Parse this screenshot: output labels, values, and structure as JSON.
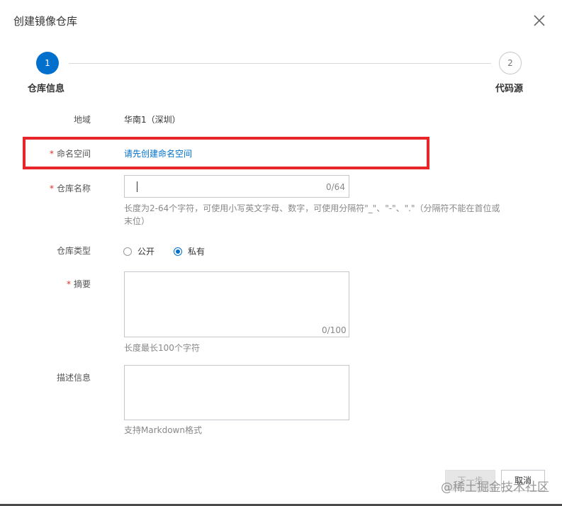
{
  "dialog": {
    "title": "创建镜像仓库",
    "close_icon": "close-icon"
  },
  "steps": [
    {
      "number": "1",
      "label": "仓库信息",
      "active": true
    },
    {
      "number": "2",
      "label": "代码源",
      "active": false
    }
  ],
  "form": {
    "region": {
      "label": "地域",
      "value": "华南1（深圳）"
    },
    "namespace": {
      "label": "命名空间",
      "required": "*",
      "link": "请先创建命名空间"
    },
    "repo_name": {
      "label": "仓库名称",
      "required": "*",
      "value": "",
      "counter": "0/64",
      "hint_line1": "长度为2-64个字符，可使用小写英文字母、数字，可使用分隔符\"_\"、\"-\"、\".\"（分隔符不能在首位或",
      "hint_line2": "末位）"
    },
    "repo_type": {
      "label": "仓库类型",
      "options": [
        {
          "label": "公开",
          "checked": false
        },
        {
          "label": "私有",
          "checked": true
        }
      ]
    },
    "summary": {
      "label": "摘要",
      "required": "*",
      "value": "",
      "counter": "0/100",
      "hint": "长度最长100个字符"
    },
    "description": {
      "label": "描述信息",
      "value": "",
      "hint": "支持Markdown格式"
    }
  },
  "footer": {
    "next_label": "下一步",
    "cancel_label": "取消"
  },
  "watermark": "@稀土掘金技术社区",
  "colors": {
    "accent": "#0070cc",
    "required": "#d93026",
    "highlight": "#e8262a"
  }
}
